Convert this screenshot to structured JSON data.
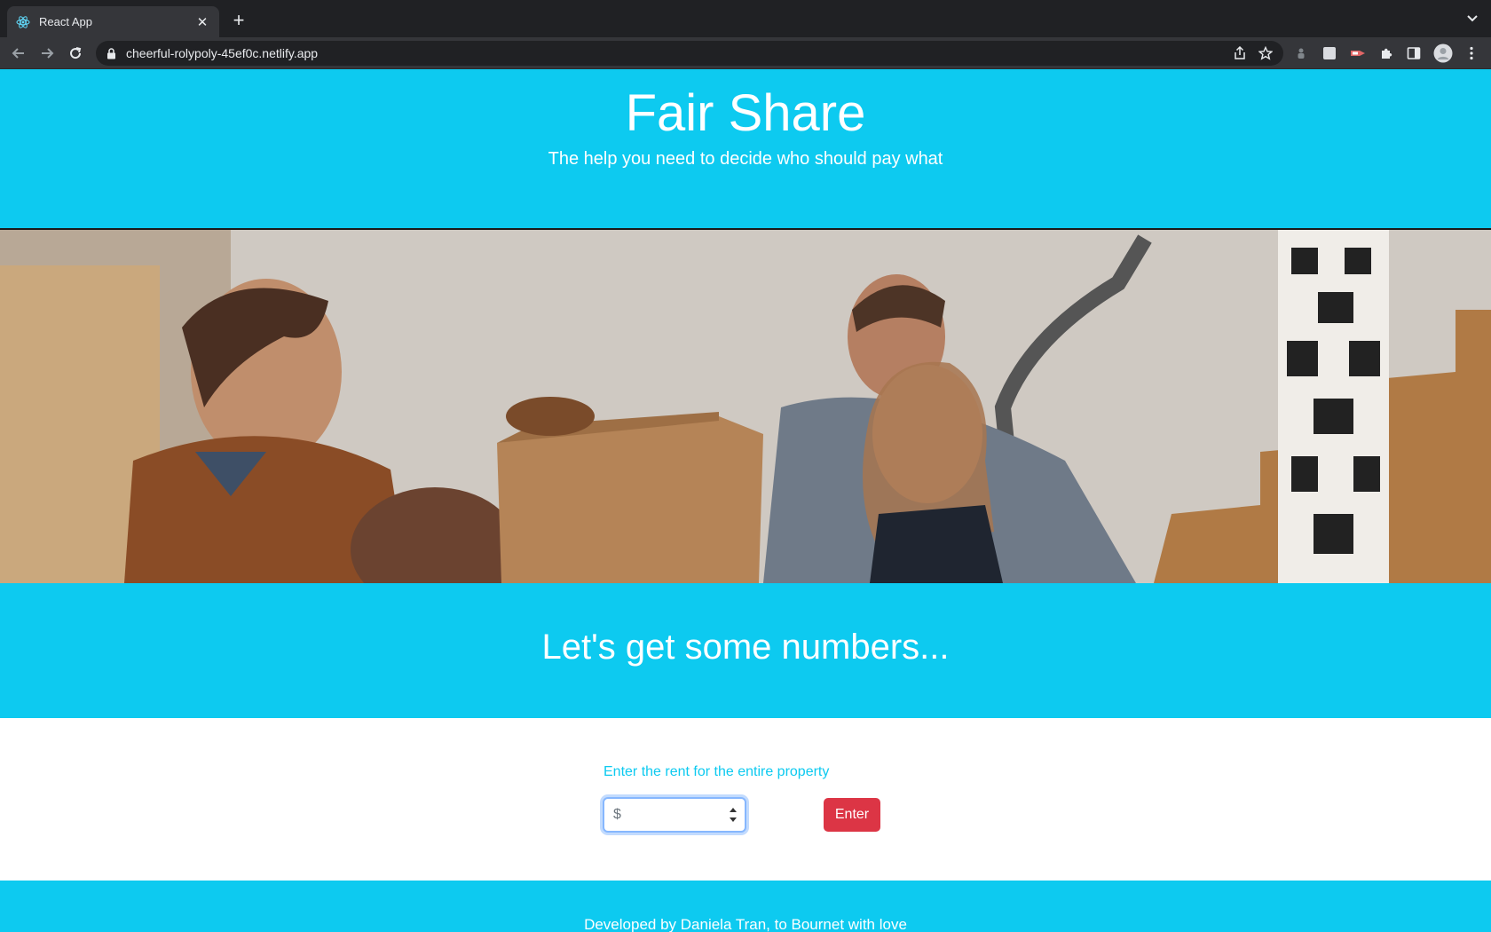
{
  "browser": {
    "tab_title": "React App",
    "url": "cheerful-rolypoly-45ef0c.netlify.app",
    "icons": [
      "react-icon",
      "close-icon",
      "plus-icon",
      "chevron-down-icon",
      "back-icon",
      "forward-icon",
      "reload-icon",
      "lock-icon",
      "share-icon",
      "star-icon",
      "extension-icon",
      "puzzle-icon",
      "sidebar-icon",
      "profile-icon",
      "kebab-menu-icon"
    ]
  },
  "header": {
    "title": "Fair Share",
    "subtitle": "The help you need to decide who should pay what"
  },
  "numbers": {
    "heading": "Let's get some numbers..."
  },
  "form": {
    "label": "Enter the rent for the entire property",
    "input_placeholder": "$",
    "input_value": "",
    "enter_label": "Enter"
  },
  "footer": {
    "text": "Developed by Daniela Tran, to Bournet with love"
  },
  "colors": {
    "brand": "#0dcaf0",
    "button": "#dc3545"
  }
}
